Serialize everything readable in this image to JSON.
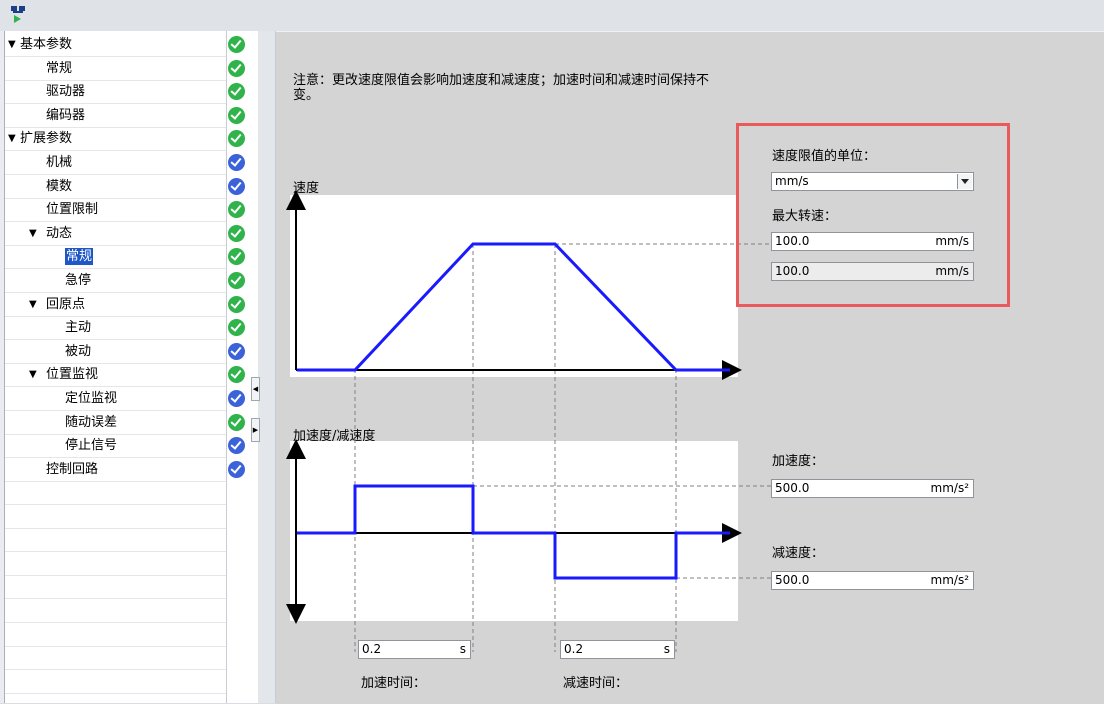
{
  "tree": [
    {
      "label": "基本参数",
      "level": 0,
      "arrow": true,
      "status": "green"
    },
    {
      "label": "常规",
      "level": 1,
      "arrow": false,
      "status": "green"
    },
    {
      "label": "驱动器",
      "level": 1,
      "arrow": false,
      "status": "green"
    },
    {
      "label": "编码器",
      "level": 1,
      "arrow": false,
      "status": "green"
    },
    {
      "label": "扩展参数",
      "level": 0,
      "arrow": true,
      "status": "green"
    },
    {
      "label": "机械",
      "level": 1,
      "arrow": false,
      "status": "blue"
    },
    {
      "label": "模数",
      "level": 1,
      "arrow": false,
      "status": "blue"
    },
    {
      "label": "位置限制",
      "level": 1,
      "arrow": false,
      "status": "green"
    },
    {
      "label": "动态",
      "level": 1,
      "arrow": true,
      "status": "green"
    },
    {
      "label": "常规",
      "level": 2,
      "arrow": false,
      "status": "green",
      "selected": true
    },
    {
      "label": "急停",
      "level": 2,
      "arrow": false,
      "status": "green"
    },
    {
      "label": "回原点",
      "level": 1,
      "arrow": true,
      "status": "green"
    },
    {
      "label": "主动",
      "level": 2,
      "arrow": false,
      "status": "green"
    },
    {
      "label": "被动",
      "level": 2,
      "arrow": false,
      "status": "blue"
    },
    {
      "label": "位置监视",
      "level": 1,
      "arrow": true,
      "status": "green"
    },
    {
      "label": "定位监视",
      "level": 2,
      "arrow": false,
      "status": "blue"
    },
    {
      "label": "随动误差",
      "level": 2,
      "arrow": false,
      "status": "green"
    },
    {
      "label": "停止信号",
      "level": 2,
      "arrow": false,
      "status": "blue"
    },
    {
      "label": "控制回路",
      "level": 1,
      "arrow": false,
      "status": "blue"
    }
  ],
  "tree_arrow_glyph": "▼",
  "note": "注意：更改速度限值会影响加速度和减速度；加速时间和减速时间保持不变。",
  "speed_panel": {
    "unit_label": "速度限值的单位：",
    "unit_value": "mm/s",
    "max_speed_label": "最大转速：",
    "max_speed_value": "100.0",
    "max_speed_unit": "mm/s",
    "max_speed_value2": "100.0",
    "max_speed_unit2": "mm/s"
  },
  "diagram": {
    "speed_title": "速度",
    "accel_title": "加速度/减速度"
  },
  "accel_panel": {
    "accel_label": "加速度：",
    "accel_value": "500.0",
    "accel_unit": "mm/s²",
    "decel_label": "减速度：",
    "decel_value": "500.0",
    "decel_unit": "mm/s²"
  },
  "times": {
    "accel_time_value": "0.2",
    "accel_time_unit": "s",
    "accel_time_label": "加速时间：",
    "decel_time_value": "0.2",
    "decel_time_unit": "s",
    "decel_time_label": "减速时间："
  },
  "colors": {
    "accent": "#1f57c7",
    "status_green": "#2fb34a",
    "status_blue": "#3b62d9",
    "highlight_box": "#ea5a5a",
    "curve": "#1a1aff"
  }
}
